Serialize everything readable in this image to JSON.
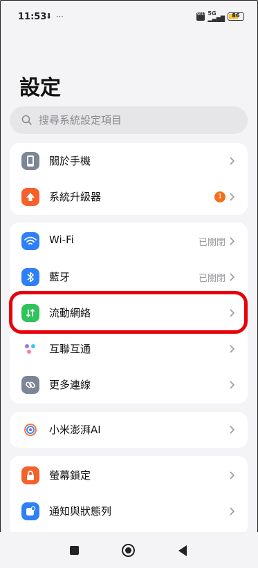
{
  "status": {
    "time": "11:53",
    "left_icons": "⬇ ⋯",
    "network": "5G",
    "battery": "86"
  },
  "header": {
    "title": "設定"
  },
  "search": {
    "placeholder": "搜尋系統設定項目"
  },
  "groups": [
    {
      "items": [
        {
          "label": "關於手機",
          "icon": "phone-icon"
        },
        {
          "label": "系統升級器",
          "icon": "upgrade-icon",
          "badge": "1"
        }
      ]
    },
    {
      "items": [
        {
          "label": "Wi-Fi",
          "icon": "wifi-icon",
          "value": "已關閉"
        },
        {
          "label": "藍牙",
          "icon": "bluetooth-icon",
          "value": "已關閉"
        },
        {
          "label": "流動網絡",
          "icon": "mobile-data-icon"
        },
        {
          "label": "互聯互通",
          "icon": "interconnect-icon"
        },
        {
          "label": "更多連線",
          "icon": "more-connections-icon"
        }
      ]
    },
    {
      "items": [
        {
          "label": "小米澎湃AI",
          "icon": "hyperai-icon"
        }
      ]
    },
    {
      "items": [
        {
          "label": "螢幕鎖定",
          "icon": "lock-icon"
        },
        {
          "label": "通知與狀態列",
          "icon": "notification-icon"
        }
      ]
    }
  ],
  "colors": {
    "accent_highlight": "#e8000b",
    "wifi": "#2f80f6",
    "bluetooth": "#2f80f6",
    "mobile_data": "#2fc35b",
    "upgrade": "#f4612b",
    "lock": "#f4612b",
    "notification": "#2f80f6"
  }
}
